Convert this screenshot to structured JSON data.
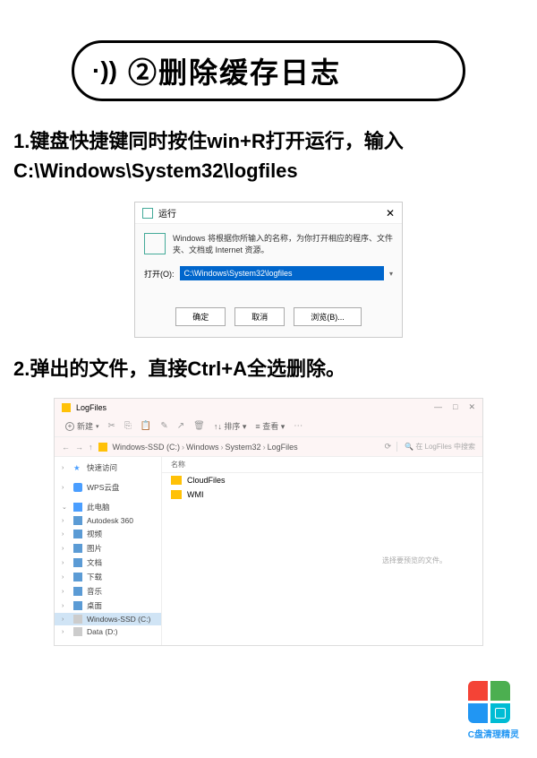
{
  "header": {
    "sound_icon": "·))",
    "title": "②删除缓存日志"
  },
  "step1": {
    "text": "1.键盘快捷键同时按住win+R打开运行，输入C:\\Windows\\System32\\logfiles"
  },
  "run_dialog": {
    "title": "运行",
    "close": "✕",
    "description": "Windows 将根据你所输入的名称，为你打开相应的程序、文件夹、文档或 Internet 资源。",
    "open_label": "打开(O):",
    "input_value": "C:\\Windows\\System32\\logfiles",
    "buttons": {
      "ok": "确定",
      "cancel": "取消",
      "browse": "浏览(B)..."
    }
  },
  "step2": {
    "text": "2.弹出的文件，直接Ctrl+A全选删除。"
  },
  "explorer": {
    "title": "LogFiles",
    "window_controls": {
      "min": "—",
      "max": "□",
      "close": "✕"
    },
    "toolbar": {
      "new": "新建",
      "sort": "排序",
      "view": "查看"
    },
    "breadcrumb": {
      "parts": [
        "Windows-SSD (C:)",
        "Windows",
        "System32",
        "LogFiles"
      ],
      "search_placeholder": "在 LogFiles 中搜索"
    },
    "content": {
      "header": "名称",
      "folders": [
        "CloudFiles",
        "WMI"
      ],
      "empty_msg": "选择要预览的文件。"
    },
    "sidebar": {
      "quick": "快速访问",
      "wps": "WPS云盘",
      "pc": "此电脑",
      "items": [
        "Autodesk 360",
        "视频",
        "图片",
        "文档",
        "下载",
        "音乐",
        "桌面",
        "Windows-SSD (C:)",
        "Data (D:)"
      ]
    }
  },
  "logo": {
    "text": "C盘清理精灵"
  }
}
